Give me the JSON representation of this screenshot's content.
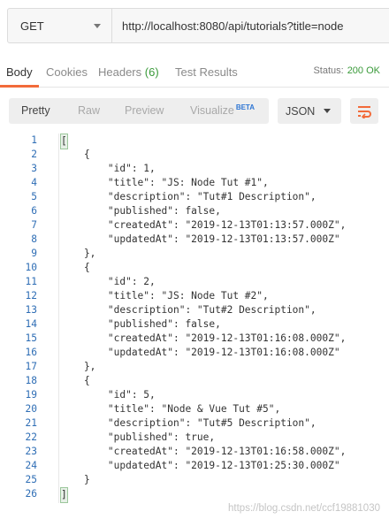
{
  "request": {
    "method": "GET",
    "url": "http://localhost:8080/api/tutorials?title=node"
  },
  "response_tabs": {
    "body": "Body",
    "cookies": "Cookies",
    "headers": "Headers",
    "headers_count": "(6)",
    "test_results": "Test Results"
  },
  "status": {
    "label": "Status:",
    "value": "200 OK"
  },
  "format_tabs": {
    "pretty": "Pretty",
    "raw": "Raw",
    "preview": "Preview",
    "visualize": "Visualize",
    "beta": "BETA"
  },
  "format_select": {
    "value": "JSON"
  },
  "wrap_icon": "wrap-lines-icon",
  "accent_color": "#f26b3a",
  "code_lines": [
    "[",
    "    {",
    "        \"id\": 1,",
    "        \"title\": \"JS: Node Tut #1\",",
    "        \"description\": \"Tut#1 Description\",",
    "        \"published\": false,",
    "        \"createdAt\": \"2019-12-13T01:13:57.000Z\",",
    "        \"updatedAt\": \"2019-12-13T01:13:57.000Z\"",
    "    },",
    "    {",
    "        \"id\": 2,",
    "        \"title\": \"JS: Node Tut #2\",",
    "        \"description\": \"Tut#2 Description\",",
    "        \"published\": false,",
    "        \"createdAt\": \"2019-12-13T01:16:08.000Z\",",
    "        \"updatedAt\": \"2019-12-13T01:16:08.000Z\"",
    "    },",
    "    {",
    "        \"id\": 5,",
    "        \"title\": \"Node & Vue Tut #5\",",
    "        \"description\": \"Tut#5 Description\",",
    "        \"published\": true,",
    "        \"createdAt\": \"2019-12-13T01:16:58.000Z\",",
    "        \"updatedAt\": \"2019-12-13T01:25:30.000Z\"",
    "    }",
    "]"
  ],
  "watermark": "https://blog.csdn.net/ccf19881030"
}
